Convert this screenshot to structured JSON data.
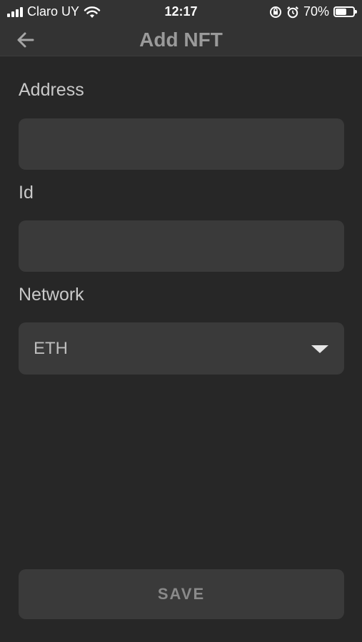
{
  "status_bar": {
    "carrier": "Claro UY",
    "time": "12:17",
    "battery": "70%",
    "battery_level": 0.7,
    "signal_icon": "signal-bars-icon",
    "wifi_icon": "wifi-icon",
    "rotation_lock_icon": "rotation-lock-icon",
    "alarm_icon": "alarm-icon"
  },
  "header": {
    "title": "Add NFT",
    "back_icon": "arrow-left-icon"
  },
  "form": {
    "address": {
      "label": "Address",
      "value": ""
    },
    "id": {
      "label": "Id",
      "value": ""
    },
    "network": {
      "label": "Network",
      "selected": "ETH"
    }
  },
  "actions": {
    "save_label": "SAVE"
  },
  "colors": {
    "background": "#272727",
    "bar": "#333333",
    "field": "#3a3a3a",
    "title": "#9a9a9a"
  }
}
